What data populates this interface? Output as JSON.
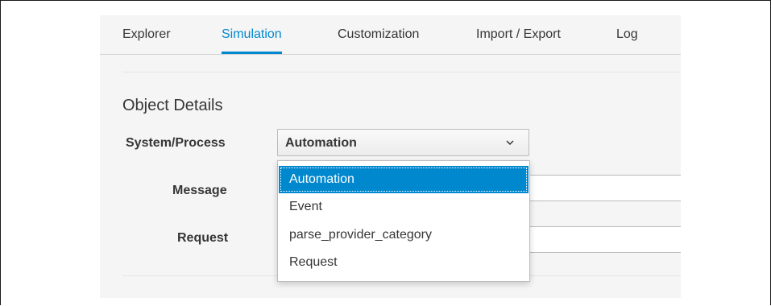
{
  "tabs": [
    {
      "label": "Explorer",
      "active": false
    },
    {
      "label": "Simulation",
      "active": true
    },
    {
      "label": "Customization",
      "active": false
    },
    {
      "label": "Import / Export",
      "active": false
    },
    {
      "label": "Log",
      "active": false
    }
  ],
  "section": {
    "title": "Object Details"
  },
  "form": {
    "system_process_label": "System/Process",
    "system_process_value": "Automation",
    "message_label": "Message",
    "message_value": "",
    "request_label": "Request",
    "request_value": ""
  },
  "dropdown": {
    "options": [
      "Automation",
      "Event",
      "parse_provider_category",
      "Request"
    ],
    "selected": "Automation"
  },
  "colors": {
    "accent": "#0088ce",
    "text": "#363636",
    "panel": "#f5f5f5"
  },
  "icons": {
    "select_chevron": "chevron-down-icon"
  }
}
